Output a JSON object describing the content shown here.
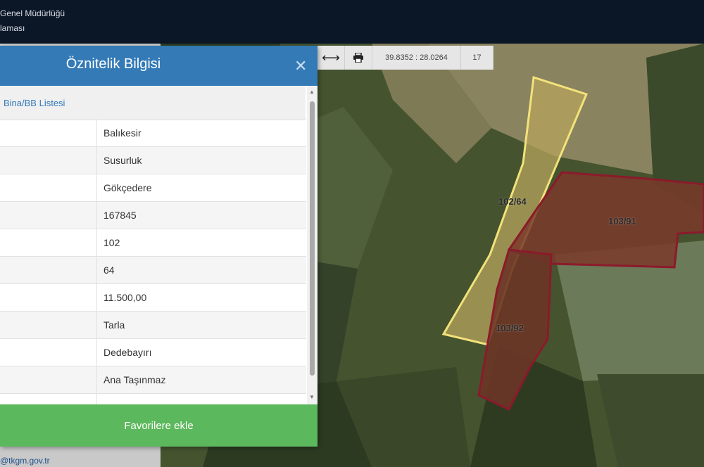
{
  "header": {
    "line1": "Genel Müdürlüğü",
    "line2": "laması"
  },
  "footer": {
    "email": "@tkgm.gov.tr"
  },
  "map_toolbar": {
    "measure_icon": "horizontal-arrows-icon",
    "print_icon": "printer-icon",
    "coordinates": "39.8352 : 28.0264",
    "zoom_level": "17"
  },
  "parcels": [
    {
      "label": "102/64",
      "border_color": "#f2e27a"
    },
    {
      "label": "103/91",
      "border_color": "#8b1a2b"
    },
    {
      "label": "103/92",
      "border_color": "#8b1a2b"
    }
  ],
  "panel": {
    "title": "Öznitelik Bilgisi",
    "close_icon": "close-icon",
    "section_link": "Bina/BB Listesi",
    "rows": [
      {
        "value": "Balıkesir"
      },
      {
        "value": "Susurluk"
      },
      {
        "value": "Gökçedere"
      },
      {
        "value": "167845"
      },
      {
        "value": "102"
      },
      {
        "value": "64"
      },
      {
        "value": "11.500,00"
      },
      {
        "value": "Tarla"
      },
      {
        "value": "Dedebayırı"
      },
      {
        "value": "Ana Taşınmaz"
      }
    ],
    "favorite_button": "Favorilere ekle"
  },
  "colors": {
    "header_blue": "#337ab7",
    "favorite_green": "#5cb85c"
  }
}
